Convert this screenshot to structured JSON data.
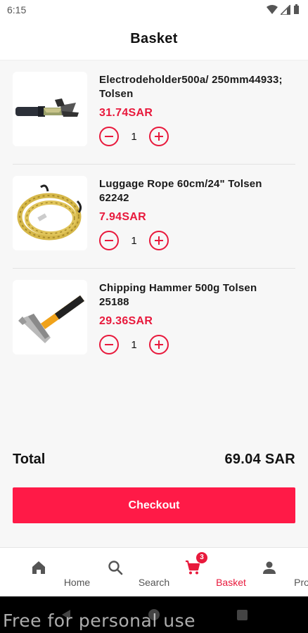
{
  "status_bar": {
    "time": "6:15"
  },
  "app_bar": {
    "title": "Basket"
  },
  "items": [
    {
      "name": "Electrodeholder500a/ 250mm44933; Tolsen",
      "price": "31.74SAR",
      "quantity": "1",
      "image": "electrode-holder"
    },
    {
      "name": "Luggage Rope 60cm/24\" Tolsen 62242",
      "price": "7.94SAR",
      "quantity": "1",
      "image": "luggage-rope"
    },
    {
      "name": "Chipping Hammer 500g Tolsen 25188",
      "price": "29.36SAR",
      "quantity": "1",
      "image": "chipping-hammer"
    }
  ],
  "summary": {
    "total_label": "Total",
    "total_value": "69.04 SAR"
  },
  "checkout_label": "Checkout",
  "bottom_nav": {
    "items": [
      {
        "label": "Home",
        "icon": "home-icon"
      },
      {
        "label": "Search",
        "icon": "search-icon"
      },
      {
        "label": "Basket",
        "icon": "cart-icon",
        "badge": "3",
        "active": true
      },
      {
        "label": "Profile",
        "icon": "profile-icon"
      }
    ]
  },
  "watermark": "Free for personal use",
  "colors": {
    "accent": "#e8193c",
    "checkout": "#ff1a47",
    "background": "#f7f7f7"
  }
}
